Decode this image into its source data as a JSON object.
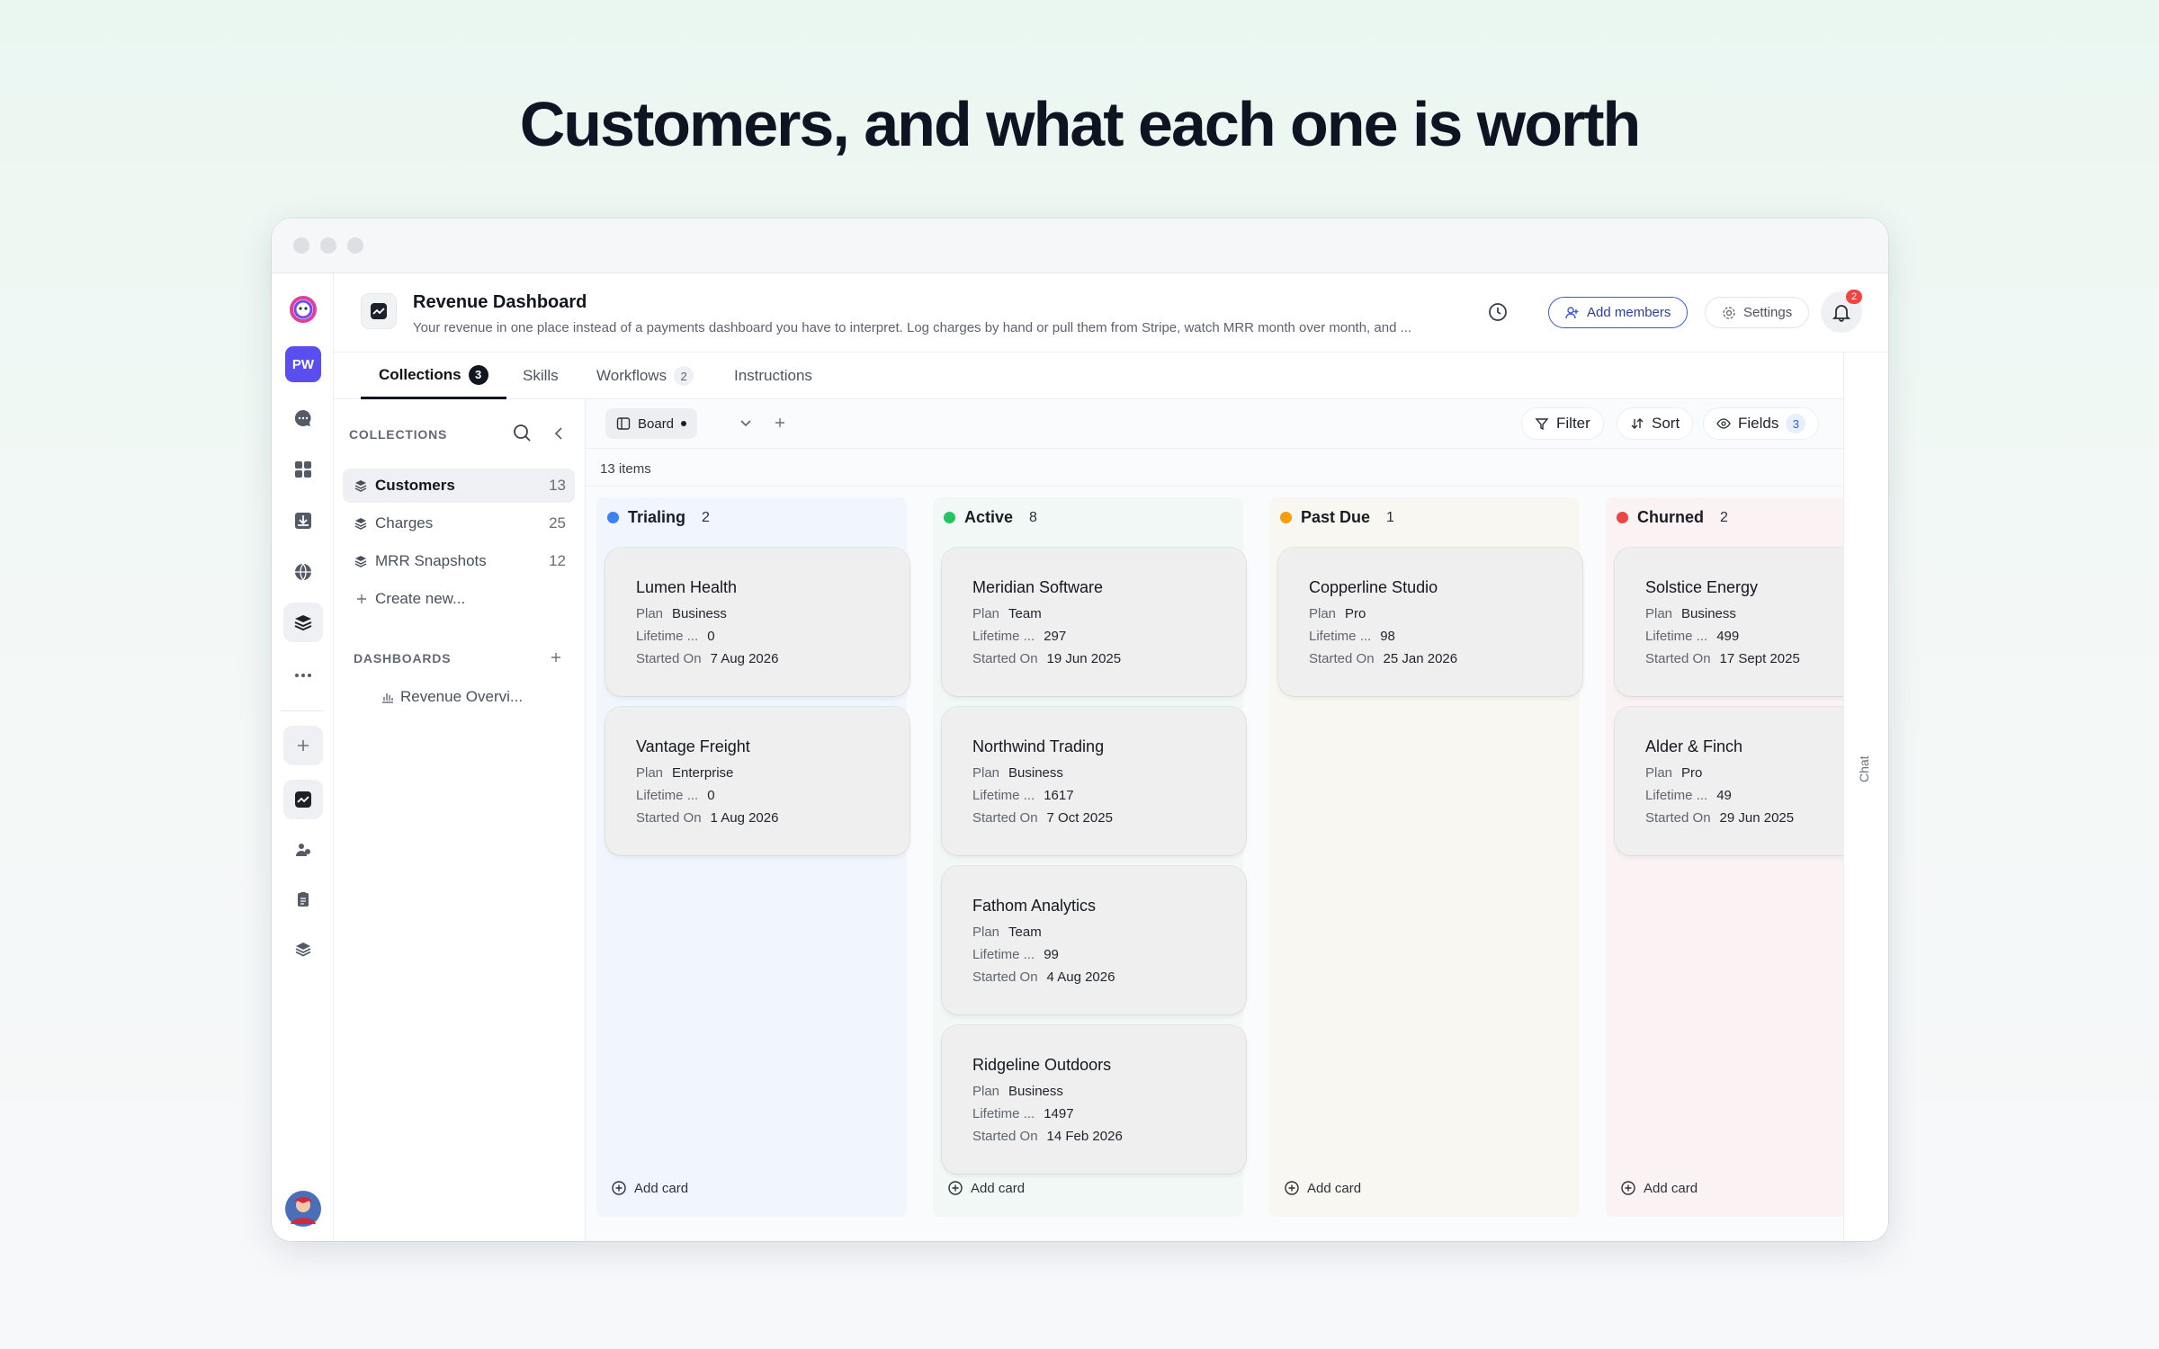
{
  "headline": "Customers, and what each one is worth",
  "header": {
    "title": "Revenue Dashboard",
    "description": "Your revenue in one place instead of a payments dashboard you have to interpret. Log charges by hand or pull them from Stripe, watch MRR month over month, and ...",
    "add_members": "Add members",
    "settings": "Settings",
    "notification_count": "2"
  },
  "rail": {
    "avatar_initials": "PW"
  },
  "tabs": [
    {
      "label": "Collections",
      "badge": "3"
    },
    {
      "label": "Skills"
    },
    {
      "label": "Workflows",
      "badge": "2"
    },
    {
      "label": "Instructions"
    }
  ],
  "collections": {
    "title": "COLLECTIONS",
    "items": [
      {
        "label": "Customers",
        "count": "13"
      },
      {
        "label": "Charges",
        "count": "25"
      },
      {
        "label": "MRR Snapshots",
        "count": "12"
      }
    ],
    "create_new": "Create new...",
    "dashboards_title": "DASHBOARDS",
    "dashboards": [
      {
        "label": "Revenue Overvi..."
      }
    ]
  },
  "toolbar": {
    "view": "Board",
    "filter": "Filter",
    "sort": "Sort",
    "fields": "Fields",
    "fields_count": "3"
  },
  "item_count": "13 items",
  "labels": {
    "plan": "Plan",
    "lifetime": "Lifetime ...",
    "started": "Started On",
    "add_card": "Add card",
    "chat": "Chat"
  },
  "columns": [
    {
      "name": "Trialing",
      "count": "2",
      "color": "#3b82f6",
      "bg": "#f1f5fd",
      "cards": [
        {
          "name": "Lumen Health",
          "plan": "Business",
          "lifetime": "0",
          "started": "7 Aug 2026"
        },
        {
          "name": "Vantage Freight",
          "plan": "Enterprise",
          "lifetime": "0",
          "started": "1 Aug 2026"
        }
      ]
    },
    {
      "name": "Active",
      "count": "8",
      "color": "#22c55e",
      "bg": "#f2f8f5",
      "cards": [
        {
          "name": "Meridian Software",
          "plan": "Team",
          "lifetime": "297",
          "started": "19 Jun 2025"
        },
        {
          "name": "Northwind Trading",
          "plan": "Business",
          "lifetime": "1617",
          "started": "7 Oct 2025"
        },
        {
          "name": "Fathom Analytics",
          "plan": "Team",
          "lifetime": "99",
          "started": "4 Aug 2026"
        },
        {
          "name": "Ridgeline Outdoors",
          "plan": "Business",
          "lifetime": "1497",
          "started": "14 Feb 2026"
        }
      ]
    },
    {
      "name": "Past Due",
      "count": "1",
      "color": "#f59e0b",
      "bg": "#f8f7f1",
      "cards": [
        {
          "name": "Copperline Studio",
          "plan": "Pro",
          "lifetime": "98",
          "started": "25 Jan 2026"
        }
      ]
    },
    {
      "name": "Churned",
      "count": "2",
      "color": "#ef4444",
      "bg": "#fbf2f4",
      "cards": [
        {
          "name": "Solstice Energy",
          "plan": "Business",
          "lifetime": "499",
          "started": "17 Sept 2025"
        },
        {
          "name": "Alder & Finch",
          "plan": "Pro",
          "lifetime": "49",
          "started": "29 Jun 2025"
        }
      ]
    }
  ]
}
